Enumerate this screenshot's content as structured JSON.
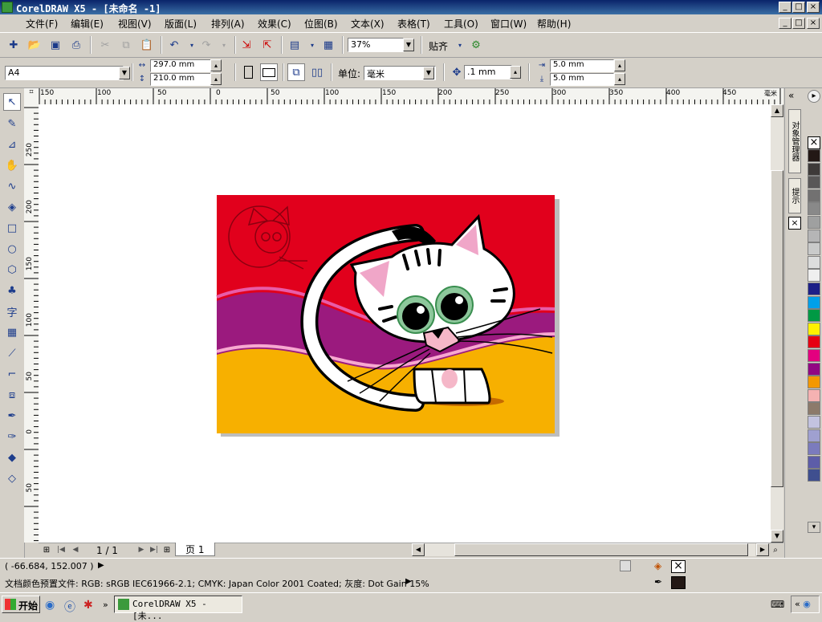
{
  "window": {
    "title": "CorelDRAW X5 - [未命名 -1]"
  },
  "menu": [
    "文件(F)",
    "编辑(E)",
    "视图(V)",
    "版面(L)",
    "排列(A)",
    "效果(C)",
    "位图(B)",
    "文本(X)",
    "表格(T)",
    "工具(O)",
    "窗口(W)",
    "帮助(H)"
  ],
  "toolbar": {
    "zoom": "37%",
    "snap_label": "贴齐"
  },
  "property_bar": {
    "page_size": "A4",
    "width": "297.0 mm",
    "height": "210.0 mm",
    "units_label": "单位:",
    "units": "毫米",
    "nudge": ".1 mm",
    "dup_x": "5.0 mm",
    "dup_y": "5.0 mm"
  },
  "ruler_top": [
    "150",
    "100",
    "50",
    "0",
    "50",
    "100",
    "150",
    "200",
    "250",
    "300",
    "350",
    "400",
    "450"
  ],
  "ruler_top_unit": "毫米",
  "ruler_left": [
    "250",
    "200",
    "150",
    "100",
    "50",
    "0",
    "50"
  ],
  "docker_tabs": {
    "object_manager": "对象管理器",
    "hints": "提示"
  },
  "page_nav": {
    "count": "1 / 1",
    "tab": "页 1"
  },
  "status": {
    "coords": "( -66.684, 152.007 )",
    "color_profile": "文档颜色预置文件: RGB: sRGB IEC61966-2.1; CMYK: Japan Color 2001 Coated; 灰度: Dot Gain 15%"
  },
  "taskbar": {
    "start": "开始",
    "task": "CorelDRAW X5 - [未..."
  },
  "palette": [
    "#ffffff",
    "#231815",
    "#3e3a39",
    "#595757",
    "#727171",
    "#898989",
    "#9fa0a0",
    "#b5b5b6",
    "#c9caca",
    "#dcdddd",
    "#efefef",
    "#1d2088",
    "#00a0e9",
    "#009944",
    "#fff100",
    "#e60012",
    "#e4007f",
    "#920783",
    "#f39800",
    "#f5b2b2",
    "#8c7a6b",
    "#c3c3e0",
    "#9fa0d0",
    "#7b7bbd",
    "#5d5da8",
    "#3f4f8f"
  ]
}
